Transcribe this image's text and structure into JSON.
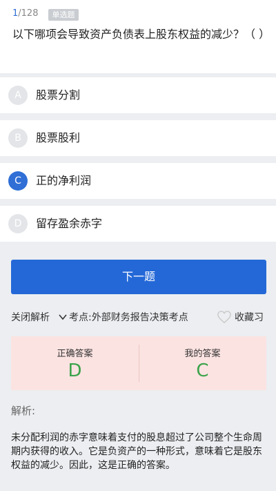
{
  "question": {
    "current": "1",
    "total": "/128",
    "type_badge": "单选题",
    "text": "以下哪项会导致资产负债表上股东权益的减少？（ ）"
  },
  "options": [
    {
      "letter": "A",
      "text": "股票分割",
      "selected": false
    },
    {
      "letter": "B",
      "text": "股票股利",
      "selected": false
    },
    {
      "letter": "C",
      "text": "正的净利润",
      "selected": true
    },
    {
      "letter": "D",
      "text": "留存盈余赤字",
      "selected": false
    }
  ],
  "next_button": "下一题",
  "toolbar": {
    "close_analysis": "关闭解析",
    "knowledge_point": "考点:外部财务报告决策考点",
    "favorite": "收藏习"
  },
  "answers": {
    "correct_label": "正确答案",
    "correct_value": "D",
    "mine_label": "我的答案",
    "mine_value": "C"
  },
  "analysis": {
    "title": "解析:",
    "text": "未分配利润的赤字意味着支付的股息超过了公司整个生命周期内获得的收入。它是负资产的一种形式，意味着它是股东权益的减少。因此，这是正确的答案。"
  },
  "colors": {
    "accent": "#2468d8",
    "answer_bg": "#fbe3e1",
    "answer_value": "#3aa34a"
  }
}
